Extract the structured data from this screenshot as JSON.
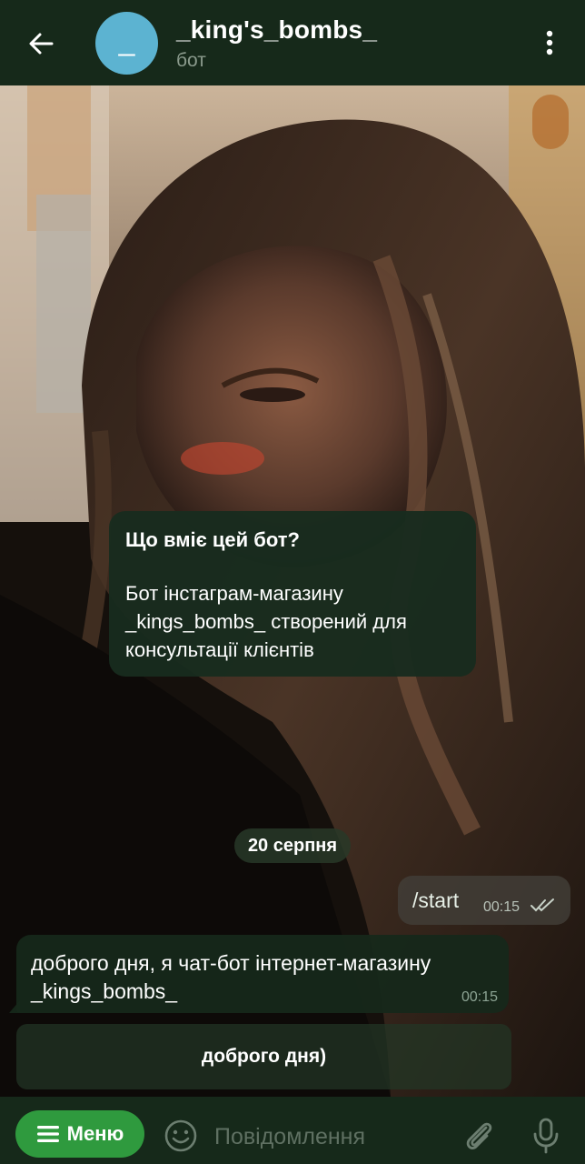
{
  "header": {
    "avatar_letter": "_",
    "title": "_king's_bombs_",
    "subtitle": "бот"
  },
  "bot_info": {
    "title": "Що вміє цей бот?",
    "description": "Бот інстаграм-магазину _kings_bombs_ створений для консультації клієнтів"
  },
  "date_separator": "20 серпня",
  "messages": [
    {
      "direction": "outgoing",
      "text": "/start",
      "time": "00:15",
      "status": "read"
    },
    {
      "direction": "incoming",
      "text": "доброго дня, я чат-бот інтернет-магазину _kings_bombs_",
      "time": "00:15"
    }
  ],
  "inline_keyboard": [
    {
      "label": "доброго дня)"
    }
  ],
  "input_bar": {
    "menu_label": "Меню",
    "placeholder": "Повідомлення"
  },
  "colors": {
    "header_bg": "#16291a",
    "menu_button": "#2f9a3e",
    "avatar_bg": "#5cb3d1"
  },
  "icons": [
    "back-arrow-icon",
    "more-vertical-icon",
    "menu-lines-icon",
    "emoji-icon",
    "paperclip-icon",
    "microphone-icon",
    "double-check-icon"
  ]
}
